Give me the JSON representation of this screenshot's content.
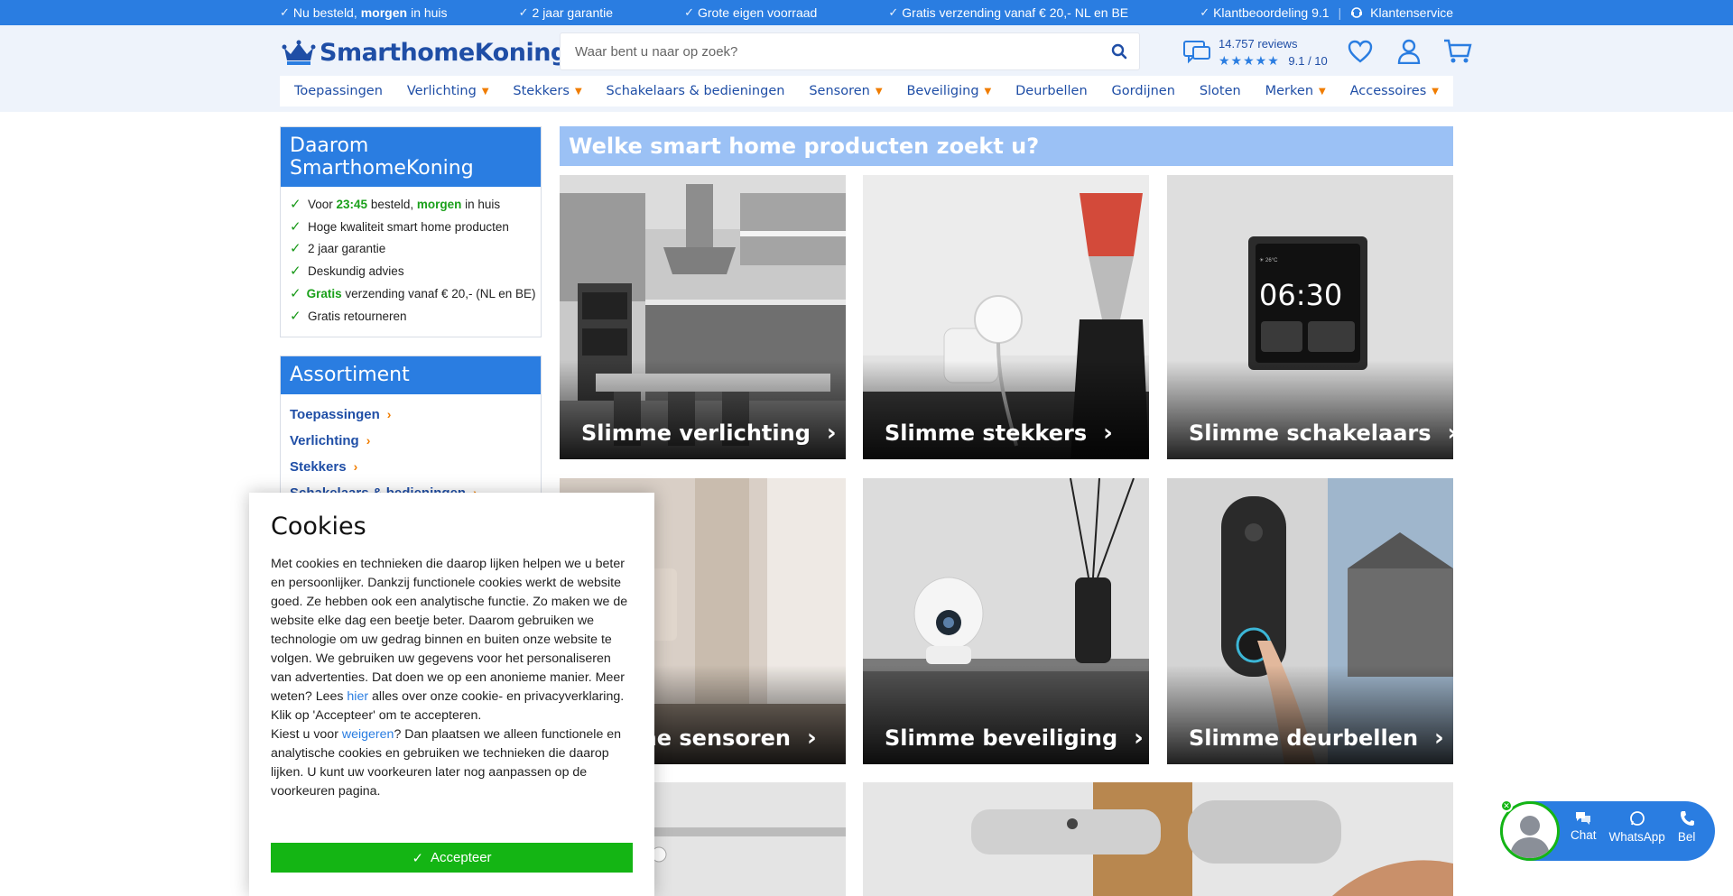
{
  "topbar": {
    "usps": [
      {
        "pre": "Nu besteld, ",
        "bold": "morgen",
        "post": " in huis"
      },
      {
        "pre": "2 jaar garantie",
        "bold": "",
        "post": ""
      },
      {
        "pre": "Grote eigen voorraad",
        "bold": "",
        "post": ""
      },
      {
        "pre": "Gratis verzending vanaf € 20,- NL en BE",
        "bold": "",
        "post": ""
      },
      {
        "pre": "Klantbeoordeling 9.1",
        "bold": "",
        "post": ""
      }
    ],
    "service": "Klantenservice"
  },
  "header": {
    "logo_text": "SmarthomeKoning",
    "search_placeholder": "Waar bent u naar op zoek?",
    "reviews_count": "14.757 reviews",
    "rating": "9.1 / 10",
    "stars": "★★★★★"
  },
  "nav": [
    {
      "label": "Toepassingen",
      "caret": false
    },
    {
      "label": "Verlichting",
      "caret": true
    },
    {
      "label": "Stekkers",
      "caret": true
    },
    {
      "label": "Schakelaars & bedieningen",
      "caret": false
    },
    {
      "label": "Sensoren",
      "caret": true
    },
    {
      "label": "Beveiliging",
      "caret": true
    },
    {
      "label": "Deurbellen",
      "caret": false
    },
    {
      "label": "Gordijnen",
      "caret": false
    },
    {
      "label": "Sloten",
      "caret": false
    },
    {
      "label": "Merken",
      "caret": true
    },
    {
      "label": "Accessoires",
      "caret": true
    }
  ],
  "why": {
    "title": "Daarom SmarthomeKoning",
    "item1": {
      "a": "Voor ",
      "time": "23:45",
      "b": " besteld, ",
      "morgen": "morgen",
      "c": " in huis"
    },
    "item2": "Hoge kwaliteit smart home producten",
    "item3": "2 jaar garantie",
    "item4": "Deskundig advies",
    "item5": {
      "gratis": "Gratis",
      "rest": " verzending vanaf € 20,- (NL en BE)"
    },
    "item6": "Gratis retourneren"
  },
  "assortiment": {
    "title": "Assortiment",
    "items": [
      "Toepassingen",
      "Verlichting",
      "Stekkers",
      "Schakelaars & bedieningen"
    ]
  },
  "main": {
    "title": "Welke smart home producten zoekt u?",
    "tiles": [
      "Slimme verlichting",
      "Slimme stekkers",
      "Slimme schakelaars",
      "Slimme sensoren",
      "Slimme beveiliging",
      "Slimme deurbellen"
    ],
    "clock": "06:30"
  },
  "cookie": {
    "title": "Cookies",
    "p1a": "Met cookies en technieken die daarop lijken helpen we u beter en persoonlijker. Dankzij functionele cookies werkt de website goed. Ze hebben ook een analytische functie. Zo maken we de website elke dag een beetje beter. Daarom gebruiken we technologie om uw gedrag binnen en buiten onze website te volgen. We gebruiken uw gegevens voor het personaliseren van advertenties. Dat doen we op een anonieme manier. Meer weten? Lees ",
    "p1link": "hier",
    "p1b": " alles over onze cookie- en privacyverklaring. Klik op 'Accepteer' om te accepteren.",
    "p2a": "Kiest u voor ",
    "p2link": "weigeren",
    "p2b": "? Dan plaatsen we alleen functionele en analytische cookies en gebruiken we technieken die daarop lijken. U kunt uw voorkeuren later nog aanpassen op de voorkeuren pagina.",
    "accept": "Accepteer"
  },
  "chat": {
    "chat": "Chat",
    "whatsapp": "WhatsApp",
    "bel": "Bel"
  },
  "colors": {
    "brand_blue": "#2a7de1",
    "dark_blue": "#1f4ea6",
    "accent_orange": "#f07d00",
    "green": "#14b514"
  }
}
